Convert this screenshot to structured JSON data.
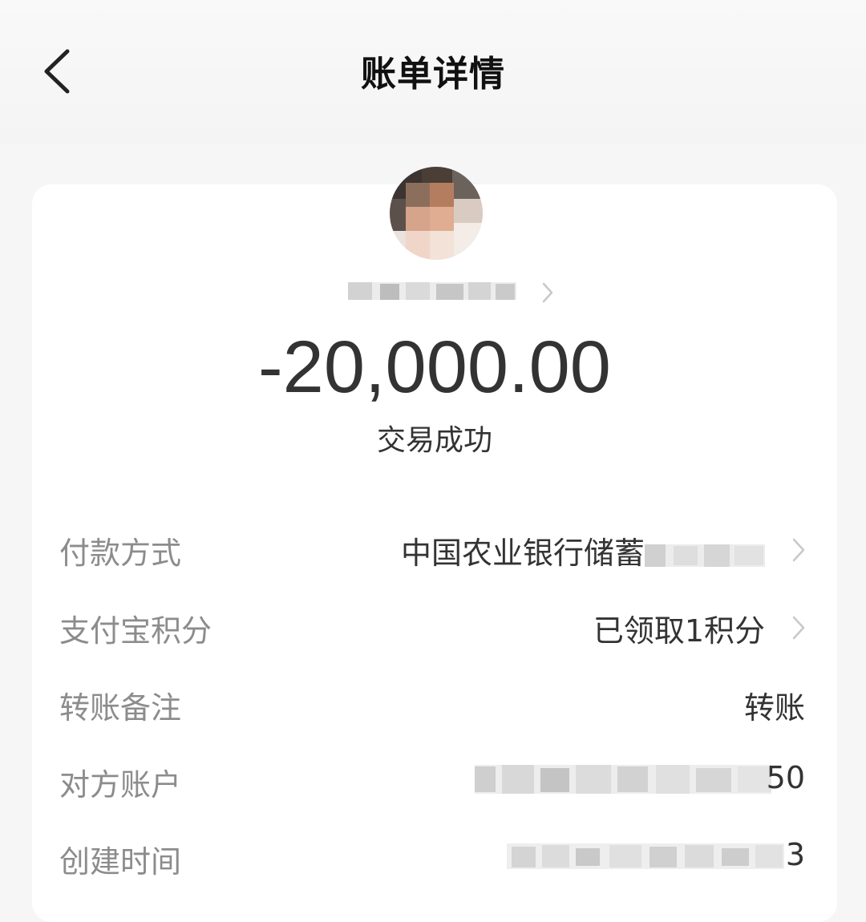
{
  "header": {
    "title": "账单详情"
  },
  "payee": {
    "amount": "-20,000.00",
    "status": "交易成功"
  },
  "details": [
    {
      "label": "付款方式",
      "value": "中国农业银行储蓄",
      "has_chevron": true
    },
    {
      "label": "支付宝积分",
      "value": "已领取1积分",
      "has_chevron": true
    },
    {
      "label": "转账备注",
      "value": "转账",
      "has_chevron": false
    },
    {
      "label": "对方账户",
      "value_tail": "50",
      "has_chevron": false
    },
    {
      "label": "创建时间",
      "value_tail": "3",
      "has_chevron": false
    }
  ],
  "colors": {
    "page_bg": "#f6f6f6",
    "card_bg": "#ffffff",
    "label": "#8c8c8c",
    "value": "#333333",
    "chevron": "#c8c8c8"
  },
  "icons": {
    "back": "chevron-left-icon",
    "row_arrow": "chevron-right-icon"
  }
}
